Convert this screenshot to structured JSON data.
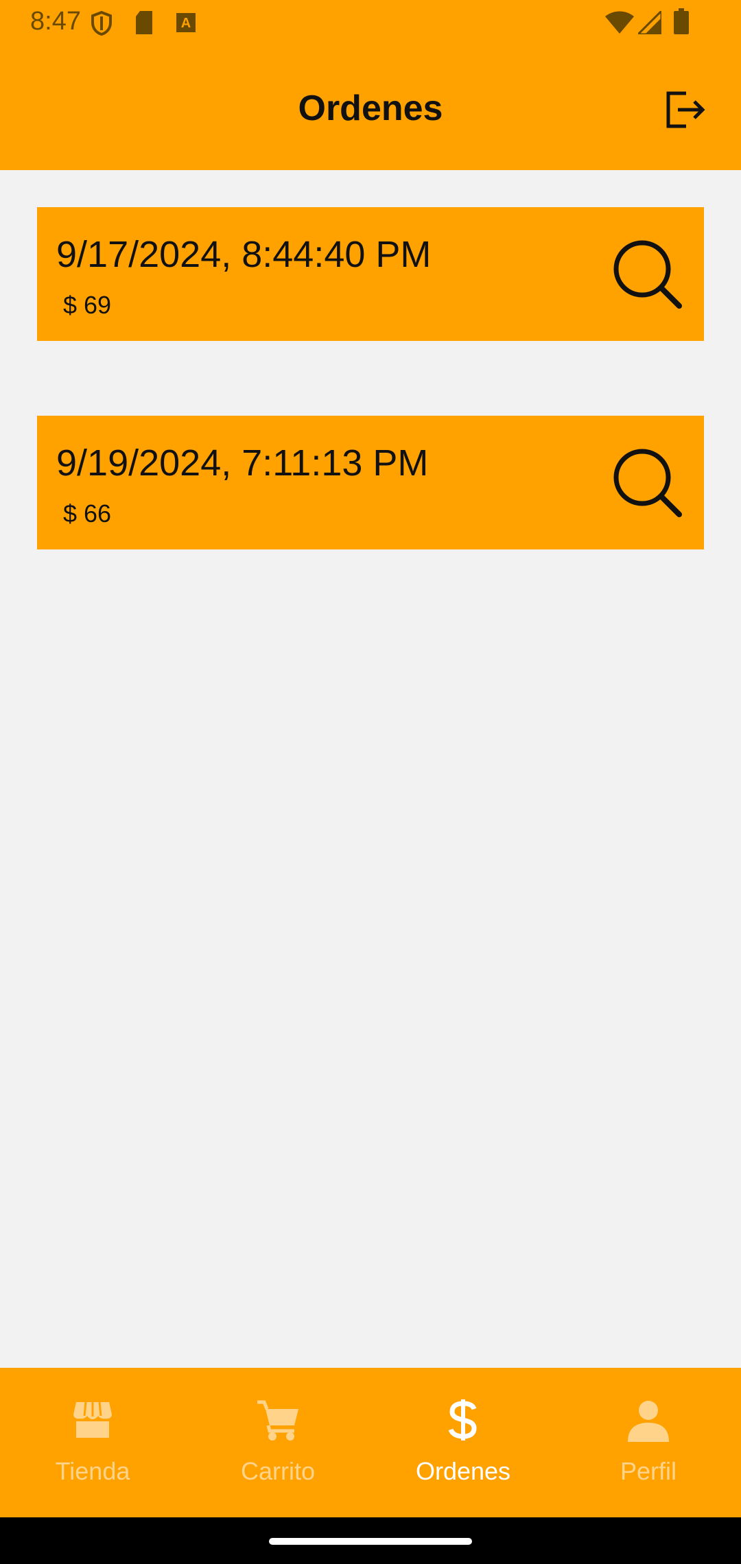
{
  "status_bar": {
    "time": "8:47"
  },
  "header": {
    "title": "Ordenes"
  },
  "orders": [
    {
      "date": "9/17/2024, 8:44:40 PM",
      "total": "$ 69"
    },
    {
      "date": "9/19/2024, 7:11:13 PM",
      "total": "$ 66"
    }
  ],
  "bottom_nav": {
    "items": [
      {
        "label": "Tienda",
        "icon": "store-icon",
        "active": false
      },
      {
        "label": "Carrito",
        "icon": "cart-icon",
        "active": false
      },
      {
        "label": "Ordenes",
        "icon": "dollar-icon",
        "active": true
      },
      {
        "label": "Perfil",
        "icon": "person-icon",
        "active": false
      }
    ]
  },
  "colors": {
    "primary": "#FFA200",
    "background": "#F2F2F2",
    "inactive_nav": "#FFD48A",
    "active_nav": "#FFFFFF"
  }
}
